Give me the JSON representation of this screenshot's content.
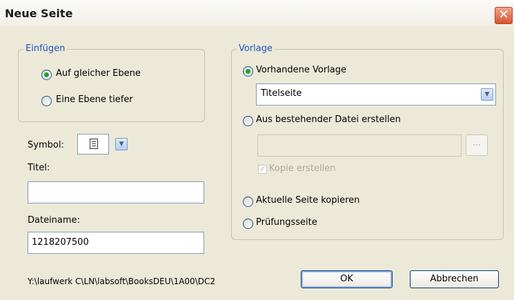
{
  "window": {
    "title": "Neue Seite",
    "close_glyph": "✕"
  },
  "insert_group": {
    "legend": "Einfügen",
    "options": [
      {
        "label": "Auf gleicher Ebene",
        "checked": true
      },
      {
        "label": "Eine Ebene tiefer",
        "checked": false
      }
    ]
  },
  "symbol": {
    "label": "Symbol:",
    "icon": "document-icon"
  },
  "title_field": {
    "label": "Titel:",
    "value": ""
  },
  "filename_field": {
    "label": "Dateiname:",
    "value": "1218207500"
  },
  "template_group": {
    "legend": "Vorlage",
    "existing_template": {
      "label": "Vorhandene Vorlage",
      "checked": true,
      "selected": "Titelseite"
    },
    "from_file": {
      "label": "Aus bestehender Datei erstellen",
      "checked": false,
      "path": "",
      "browse_label": "...",
      "copy_label": "Kopie erstellen",
      "copy_checked": true
    },
    "copy_current": {
      "label": "Aktuelle Seite kopieren",
      "checked": false
    },
    "exam_page": {
      "label": "Prüfungsseite",
      "checked": false
    }
  },
  "path_text": "Y:\\laufwerk C\\LN\\labsoft\\BooksDEU\\1A00\\DC2",
  "buttons": {
    "ok": "OK",
    "cancel": "Abbrechen"
  },
  "colors": {
    "legend": "#1f50c8",
    "radio_dot": "#21a121",
    "close": "#d9542f"
  }
}
